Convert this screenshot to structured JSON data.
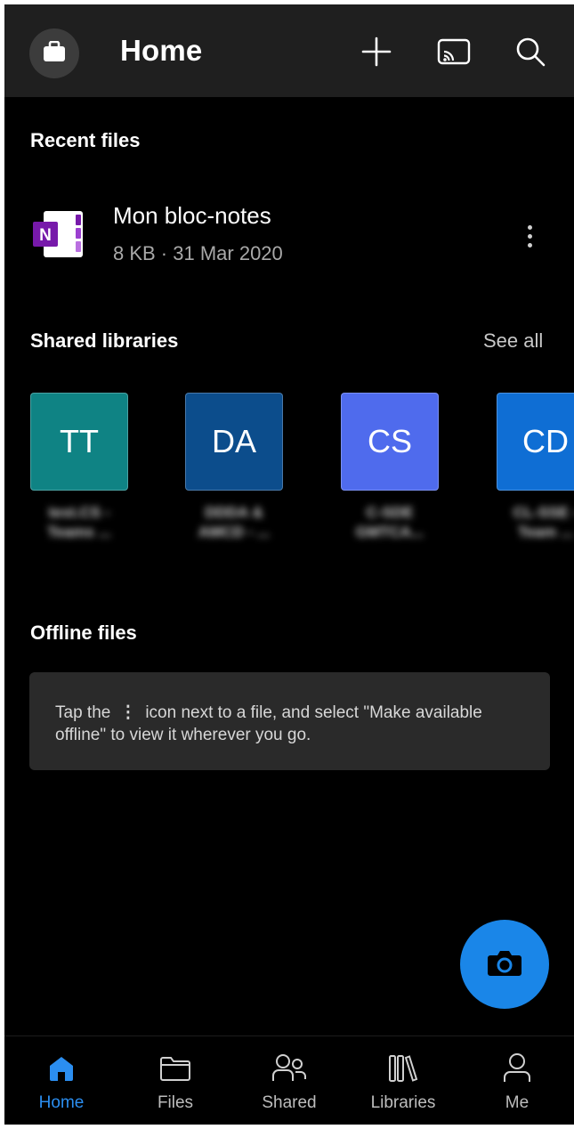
{
  "header": {
    "title": "Home",
    "icons": {
      "account": "briefcase-icon",
      "add": "plus-icon",
      "cast": "cast-icon",
      "search": "search-icon"
    }
  },
  "recent": {
    "title": "Recent files",
    "items": [
      {
        "name": "Mon bloc-notes",
        "meta": "8 KB · 31 Mar 2020",
        "icon": "onenote-icon"
      }
    ]
  },
  "shared_libraries": {
    "title": "Shared libraries",
    "see_all": "See all",
    "items": [
      {
        "initials": "TT",
        "color": "#0f8384",
        "name": "test.CS - Teams ..."
      },
      {
        "initials": "DA",
        "color": "#0c4d8c",
        "name": "DDDA & AMCD - ..."
      },
      {
        "initials": "CS",
        "color": "#4f6bed",
        "name": "C-SDE GMTCA..."
      },
      {
        "initials": "CD",
        "color": "#0f6ed4",
        "name": "CL-SSE - Team ..."
      }
    ]
  },
  "offline": {
    "title": "Offline files",
    "message_before": "Tap the",
    "message_icon": "⋮",
    "message_after": "icon next to a file, and select \"Make available offline\" to view it wherever you go."
  },
  "fab": {
    "icon": "camera-icon"
  },
  "nav": {
    "items": [
      {
        "label": "Home",
        "icon": "home-icon",
        "active": true
      },
      {
        "label": "Files",
        "icon": "folder-icon",
        "active": false
      },
      {
        "label": "Shared",
        "icon": "people-icon",
        "active": false
      },
      {
        "label": "Libraries",
        "icon": "libraries-icon",
        "active": false
      },
      {
        "label": "Me",
        "icon": "person-icon",
        "active": false
      }
    ]
  },
  "colors": {
    "accent": "#1a86e8",
    "onenote": "#7719aa",
    "header_bg": "#1f1f1f",
    "background": "#000000"
  }
}
